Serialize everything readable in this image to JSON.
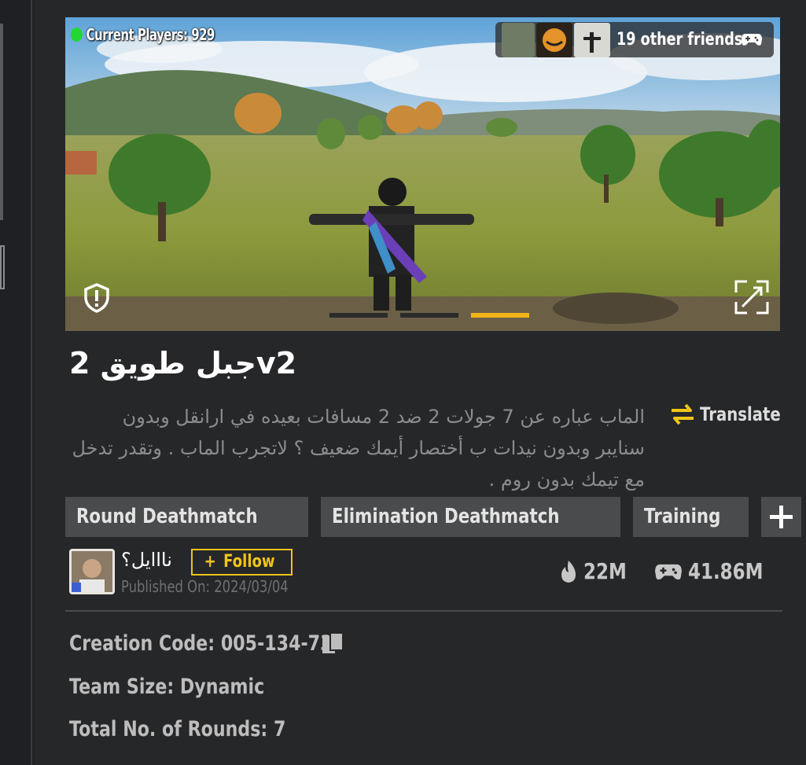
{
  "preview": {
    "current_players_label": "Current Players: 929",
    "friends_label": "19 other friends",
    "indicator": {
      "total": 3,
      "active_index": 2
    }
  },
  "map": {
    "title": "جبل طويق 2v2",
    "description": "الماب عباره عن 7 جولات 2 ضد 2 مسافات بعيده في ارانقل وبدون سنايبر وبدون نيدات ب أختصار أيمك ضعيف ؟ لاتجرب الماب . وتقدر تدخل مع تيمك بدون روم .",
    "translate_label": "Translate",
    "tags": [
      "Round Deathmatch",
      "Elimination Deathmatch",
      "Training"
    ]
  },
  "author": {
    "name": "نااايل؟",
    "follow_label": "Follow",
    "published": "Published On: 2024/03/04"
  },
  "stats": {
    "popularity": "22M",
    "plays": "41.86M"
  },
  "details": {
    "creation_code": "Creation Code: 005-134-737",
    "team_size": "Team Size: Dynamic",
    "rounds": "Total No. of Rounds: 7"
  },
  "colors": {
    "accent": "#f0c419",
    "online": "#22d633",
    "tag_bg": "#4a4b4d",
    "panel_bg": "#262729"
  },
  "icons": [
    "shield-alert-icon",
    "fullscreen-icon",
    "gamepad-icon",
    "swap-arrows-icon",
    "plus-icon",
    "flame-icon",
    "copy-icon"
  ]
}
